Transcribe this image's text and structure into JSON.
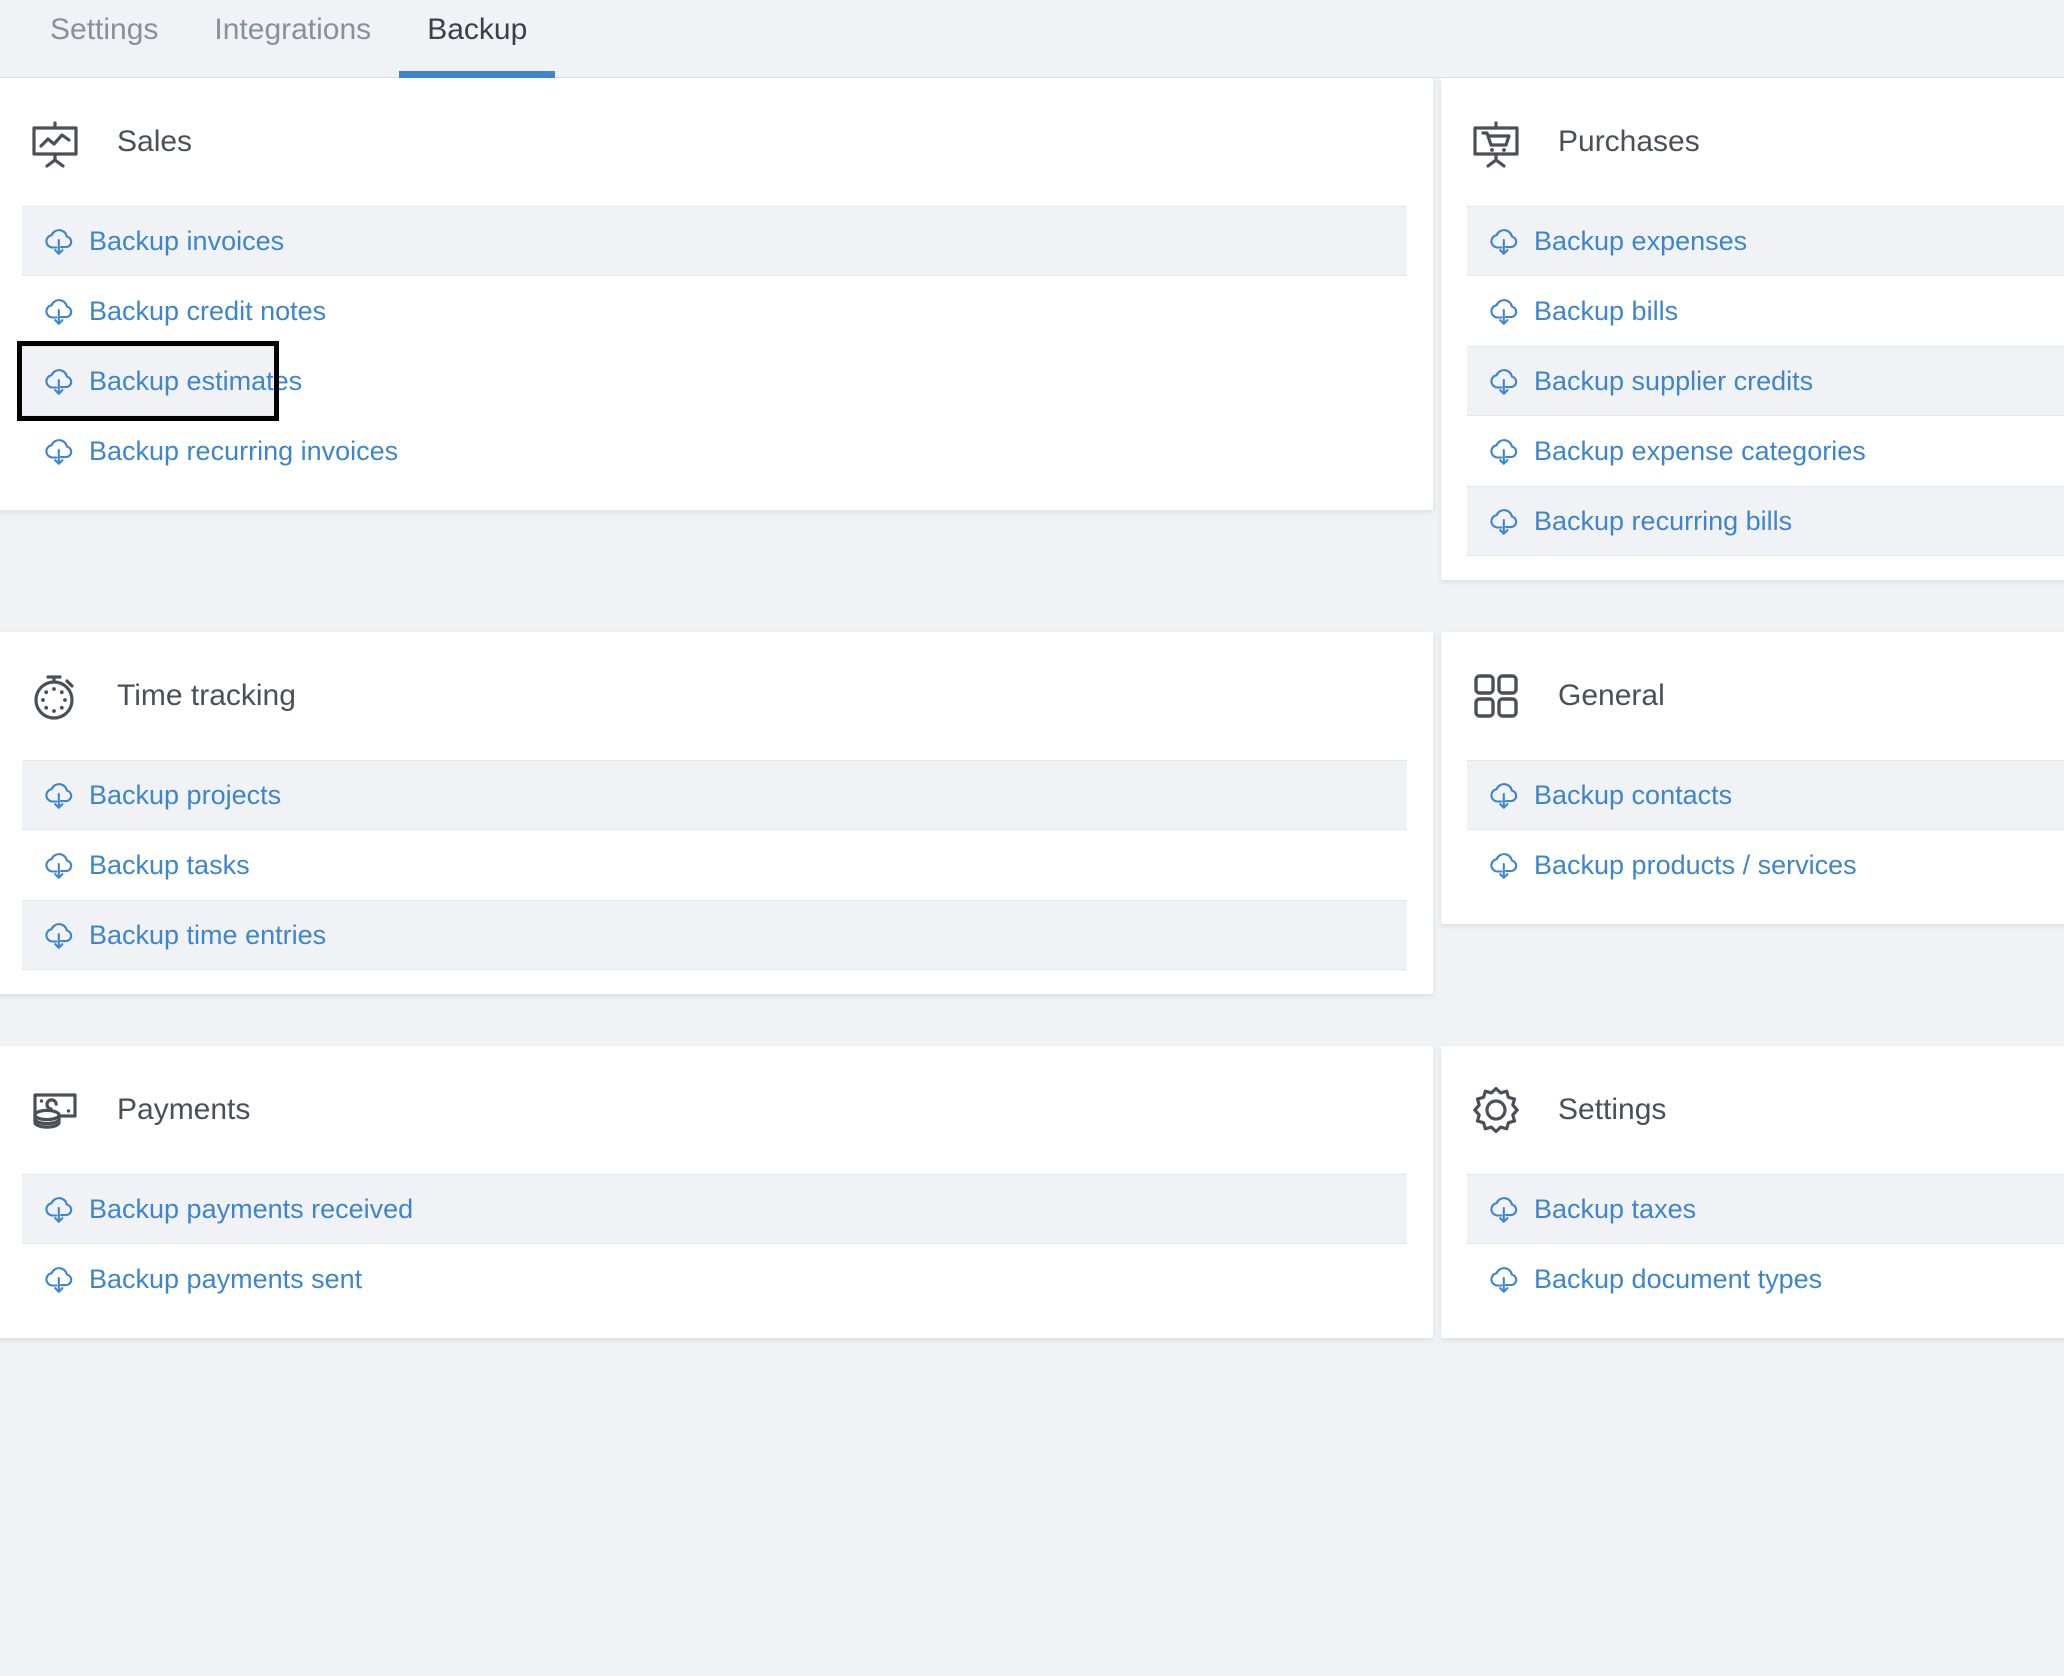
{
  "tabs": [
    {
      "label": "Settings",
      "active": false,
      "name": "tab-settings"
    },
    {
      "label": "Integrations",
      "active": false,
      "name": "tab-integrations"
    },
    {
      "label": "Backup",
      "active": true,
      "name": "tab-backup"
    }
  ],
  "colors": {
    "accent": "#3d85cd",
    "link": "#3d85cd",
    "page_bg": "#f1f2f6",
    "card_bg": "#ffffff",
    "row_alt_bg": "#f1f2f6",
    "title_text": "#4b4f57",
    "tab_inactive": "#8a8f9a",
    "focus_outline": "#000000"
  },
  "cards": {
    "sales": {
      "title": "Sales",
      "icon": "presentation-chart-icon",
      "items": [
        {
          "label": "Backup invoices",
          "icon": "cloud-download-icon",
          "alt": true,
          "focused": false
        },
        {
          "label": "Backup credit notes",
          "icon": "cloud-download-icon",
          "alt": false,
          "focused": false
        },
        {
          "label": "Backup estimates",
          "icon": "cloud-download-icon",
          "alt": true,
          "focused": true
        },
        {
          "label": "Backup recurring invoices",
          "icon": "cloud-download-icon",
          "alt": false,
          "focused": false
        }
      ]
    },
    "purchases": {
      "title": "Purchases",
      "icon": "presentation-cart-icon",
      "items": [
        {
          "label": "Backup expenses",
          "icon": "cloud-download-icon",
          "alt": true,
          "focused": false
        },
        {
          "label": "Backup bills",
          "icon": "cloud-download-icon",
          "alt": false,
          "focused": false
        },
        {
          "label": "Backup supplier credits",
          "icon": "cloud-download-icon",
          "alt": true,
          "focused": false
        },
        {
          "label": "Backup expense categories",
          "icon": "cloud-download-icon",
          "alt": false,
          "focused": false
        },
        {
          "label": "Backup recurring bills",
          "icon": "cloud-download-icon",
          "alt": true,
          "focused": false
        }
      ]
    },
    "time_tracking": {
      "title": "Time tracking",
      "icon": "stopwatch-icon",
      "items": [
        {
          "label": "Backup projects",
          "icon": "cloud-download-icon",
          "alt": true,
          "focused": false
        },
        {
          "label": "Backup tasks",
          "icon": "cloud-download-icon",
          "alt": false,
          "focused": false
        },
        {
          "label": "Backup time entries",
          "icon": "cloud-download-icon",
          "alt": true,
          "focused": false
        }
      ]
    },
    "general": {
      "title": "General",
      "icon": "grid-squares-icon",
      "items": [
        {
          "label": "Backup contacts",
          "icon": "cloud-download-icon",
          "alt": true,
          "focused": false
        },
        {
          "label": "Backup products / services",
          "icon": "cloud-download-icon",
          "alt": false,
          "focused": false
        }
      ]
    },
    "payments": {
      "title": "Payments",
      "icon": "banknote-coins-icon",
      "items": [
        {
          "label": "Backup payments received",
          "icon": "cloud-download-icon",
          "alt": true,
          "focused": false
        },
        {
          "label": "Backup payments sent",
          "icon": "cloud-download-icon",
          "alt": false,
          "focused": false
        }
      ]
    },
    "settings": {
      "title": "Settings",
      "icon": "gear-icon",
      "items": [
        {
          "label": "Backup taxes",
          "icon": "cloud-download-icon",
          "alt": true,
          "focused": false
        },
        {
          "label": "Backup document types",
          "icon": "cloud-download-icon",
          "alt": false,
          "focused": false
        }
      ]
    }
  }
}
